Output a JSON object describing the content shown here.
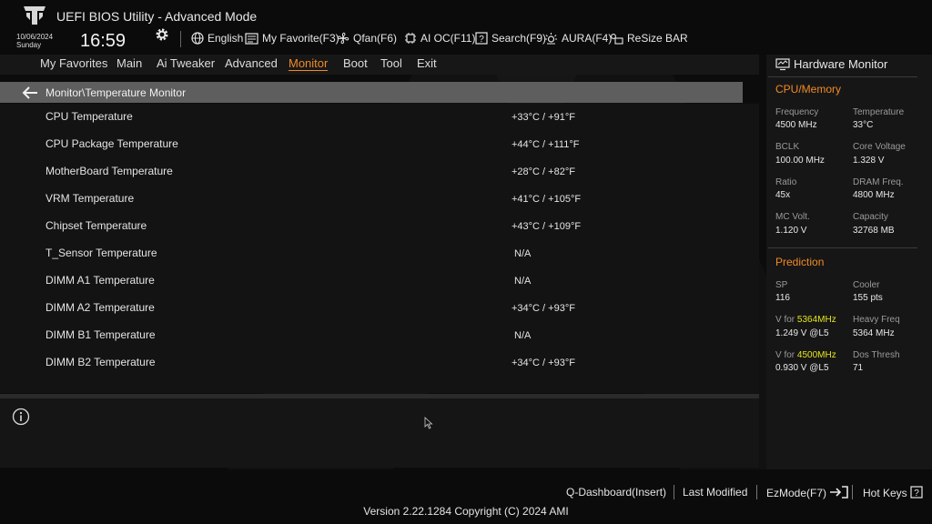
{
  "app": {
    "title": "UEFI BIOS Utility - Advanced Mode"
  },
  "status": {
    "date": "10/06/2024",
    "day": "Sunday",
    "time": "16:59"
  },
  "toolbar": [
    {
      "label": "English",
      "icon": "globe-icon"
    },
    {
      "label": "My Favorite(F3)",
      "icon": "favorite-icon"
    },
    {
      "label": "Qfan(F6)",
      "icon": "fan-icon"
    },
    {
      "label": "AI OC(F11)",
      "icon": "ai-oc-icon"
    },
    {
      "label": "Search(F9)",
      "icon": "search-icon"
    },
    {
      "label": "AURA(F4)",
      "icon": "aura-icon"
    },
    {
      "label": "ReSize BAR",
      "icon": "resize-bar-icon"
    }
  ],
  "menu": {
    "items": [
      "My Favorites",
      "Main",
      "Ai Tweaker",
      "Advanced",
      "Monitor",
      "Boot",
      "Tool",
      "Exit"
    ],
    "active": "Monitor"
  },
  "breadcrumb": "Monitor\\Temperature Monitor",
  "temperatures": [
    {
      "label": "CPU Temperature",
      "value": "+33°C / +91°F"
    },
    {
      "label": "CPU Package Temperature",
      "value": "+44°C / +111°F"
    },
    {
      "label": "MotherBoard Temperature",
      "value": "+28°C / +82°F"
    },
    {
      "label": "VRM Temperature",
      "value": "+41°C / +105°F"
    },
    {
      "label": "Chipset Temperature",
      "value": "+43°C / +109°F"
    },
    {
      "label": "T_Sensor Temperature",
      "value": "N/A"
    },
    {
      "label": "DIMM A1 Temperature",
      "value": "N/A"
    },
    {
      "label": "DIMM A2 Temperature",
      "value": "+34°C / +93°F"
    },
    {
      "label": "DIMM B1 Temperature",
      "value": "N/A"
    },
    {
      "label": "DIMM B2 Temperature",
      "value": "+34°C / +93°F"
    }
  ],
  "hardware_monitor": {
    "title": "Hardware Monitor",
    "cpu_memory": {
      "heading": "CPU/Memory",
      "fields": [
        {
          "label": "Frequency",
          "value": "4500 MHz"
        },
        {
          "label": "Temperature",
          "value": "33°C"
        },
        {
          "label": "BCLK",
          "value": "100.00 MHz"
        },
        {
          "label": "Core Voltage",
          "value": "1.328 V"
        },
        {
          "label": "Ratio",
          "value": "45x"
        },
        {
          "label": "DRAM Freq.",
          "value": "4800 MHz"
        },
        {
          "label": "MC Volt.",
          "value": "1.120 V"
        },
        {
          "label": "Capacity",
          "value": "32768 MB"
        }
      ]
    },
    "prediction": {
      "heading": "Prediction",
      "sp_label": "SP",
      "sp_value": "116",
      "cooler_label": "Cooler",
      "cooler_value": "155 pts",
      "v1_prefix": "V for ",
      "v1_freq": "5364MHz",
      "v1_value": "1.249 V @L5",
      "heavy_label": "Heavy Freq",
      "heavy_value": "5364 MHz",
      "v2_prefix": "V for ",
      "v2_freq": "4500MHz",
      "v2_value": "0.930 V @L5",
      "dos_label": "Dos Thresh",
      "dos_value": "71"
    }
  },
  "footer": {
    "qdashboard": "Q-Dashboard(Insert)",
    "last_modified": "Last Modified",
    "ezmode": "EzMode(F7)",
    "hotkeys": "Hot Keys",
    "version": "Version 2.22.1284 Copyright (C) 2024 AMI"
  },
  "colors": {
    "accent": "#f08a24",
    "highlight": "#e6e619",
    "breadcrumb_bg": "#5e5e5e"
  }
}
